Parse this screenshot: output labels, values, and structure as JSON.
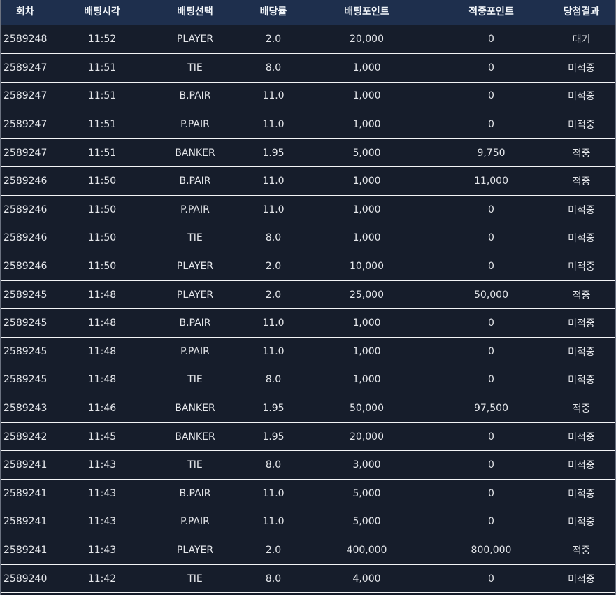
{
  "columns": [
    "회차",
    "배팅시각",
    "배팅선택",
    "배당률",
    "배팅포인트",
    "적중포인트",
    "당첨결과"
  ],
  "rows": [
    {
      "round": "2589248",
      "time": "11:52",
      "pick": "PLAYER",
      "odds": "2.0",
      "bet": "20,000",
      "win": "0",
      "result": "대기"
    },
    {
      "round": "2589247",
      "time": "11:51",
      "pick": "TIE",
      "odds": "8.0",
      "bet": "1,000",
      "win": "0",
      "result": "미적중"
    },
    {
      "round": "2589247",
      "time": "11:51",
      "pick": "B.PAIR",
      "odds": "11.0",
      "bet": "1,000",
      "win": "0",
      "result": "미적중"
    },
    {
      "round": "2589247",
      "time": "11:51",
      "pick": "P.PAIR",
      "odds": "11.0",
      "bet": "1,000",
      "win": "0",
      "result": "미적중"
    },
    {
      "round": "2589247",
      "time": "11:51",
      "pick": "BANKER",
      "odds": "1.95",
      "bet": "5,000",
      "win": "9,750",
      "result": "적중"
    },
    {
      "round": "2589246",
      "time": "11:50",
      "pick": "B.PAIR",
      "odds": "11.0",
      "bet": "1,000",
      "win": "11,000",
      "result": "적중"
    },
    {
      "round": "2589246",
      "time": "11:50",
      "pick": "P.PAIR",
      "odds": "11.0",
      "bet": "1,000",
      "win": "0",
      "result": "미적중"
    },
    {
      "round": "2589246",
      "time": "11:50",
      "pick": "TIE",
      "odds": "8.0",
      "bet": "1,000",
      "win": "0",
      "result": "미적중"
    },
    {
      "round": "2589246",
      "time": "11:50",
      "pick": "PLAYER",
      "odds": "2.0",
      "bet": "10,000",
      "win": "0",
      "result": "미적중"
    },
    {
      "round": "2589245",
      "time": "11:48",
      "pick": "PLAYER",
      "odds": "2.0",
      "bet": "25,000",
      "win": "50,000",
      "result": "적중"
    },
    {
      "round": "2589245",
      "time": "11:48",
      "pick": "B.PAIR",
      "odds": "11.0",
      "bet": "1,000",
      "win": "0",
      "result": "미적중"
    },
    {
      "round": "2589245",
      "time": "11:48",
      "pick": "P.PAIR",
      "odds": "11.0",
      "bet": "1,000",
      "win": "0",
      "result": "미적중"
    },
    {
      "round": "2589245",
      "time": "11:48",
      "pick": "TIE",
      "odds": "8.0",
      "bet": "1,000",
      "win": "0",
      "result": "미적중"
    },
    {
      "round": "2589243",
      "time": "11:46",
      "pick": "BANKER",
      "odds": "1.95",
      "bet": "50,000",
      "win": "97,500",
      "result": "적중"
    },
    {
      "round": "2589242",
      "time": "11:45",
      "pick": "BANKER",
      "odds": "1.95",
      "bet": "20,000",
      "win": "0",
      "result": "미적중"
    },
    {
      "round": "2589241",
      "time": "11:43",
      "pick": "TIE",
      "odds": "8.0",
      "bet": "3,000",
      "win": "0",
      "result": "미적중"
    },
    {
      "round": "2589241",
      "time": "11:43",
      "pick": "B.PAIR",
      "odds": "11.0",
      "bet": "5,000",
      "win": "0",
      "result": "미적중"
    },
    {
      "round": "2589241",
      "time": "11:43",
      "pick": "P.PAIR",
      "odds": "11.0",
      "bet": "5,000",
      "win": "0",
      "result": "미적중"
    },
    {
      "round": "2589241",
      "time": "11:43",
      "pick": "PLAYER",
      "odds": "2.0",
      "bet": "400,000",
      "win": "800,000",
      "result": "적중"
    },
    {
      "round": "2589240",
      "time": "11:42",
      "pick": "TIE",
      "odds": "8.0",
      "bet": "4,000",
      "win": "0",
      "result": "미적중"
    }
  ],
  "colors": {
    "header_bg": "#1e2f4d",
    "body_bg": "#161d2b",
    "row_divider": "#f3f4f6",
    "text": "#e5e7eb"
  }
}
